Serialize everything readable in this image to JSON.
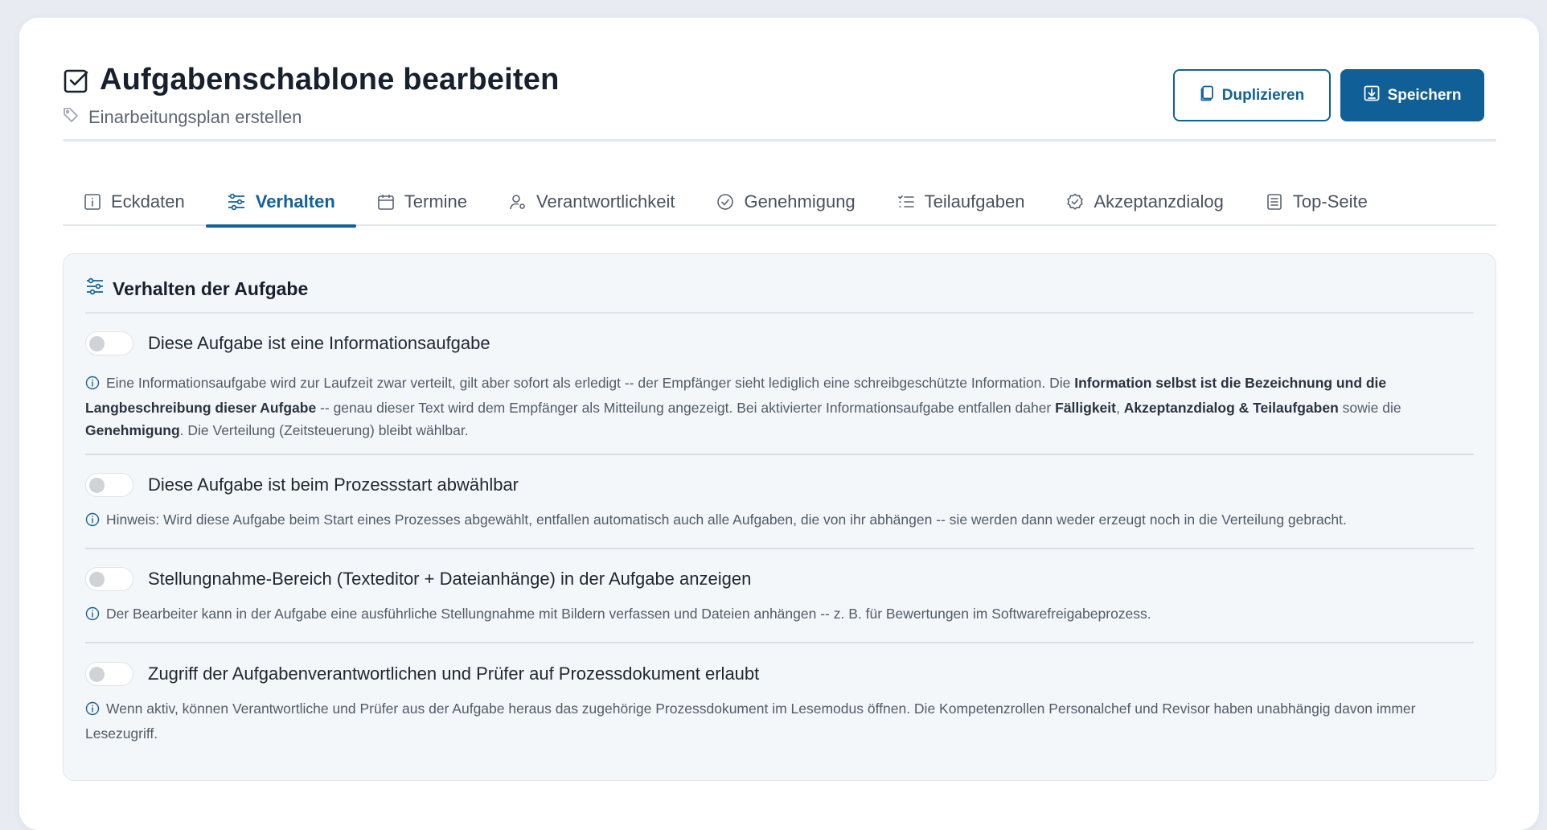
{
  "header": {
    "title": "Aufgabenschablone bearbeiten",
    "subtitle": "Einarbeitungsplan erstellen",
    "title_icon": "checkbox-icon",
    "subtitle_icon": "tag-icon"
  },
  "actions": {
    "duplicate_label": "Duplizieren",
    "save_label": "Speichern"
  },
  "tabs": [
    {
      "label": "Eckdaten",
      "icon": "info-icon",
      "active": false
    },
    {
      "label": "Verhalten",
      "icon": "sliders-icon",
      "active": true
    },
    {
      "label": "Termine",
      "icon": "calendar-icon",
      "active": false
    },
    {
      "label": "Verantwortlichkeit",
      "icon": "user-settings-icon",
      "active": false
    },
    {
      "label": "Genehmigung",
      "icon": "check-circle-icon",
      "active": false
    },
    {
      "label": "Teilaufgaben",
      "icon": "list-check-icon",
      "active": false
    },
    {
      "label": "Akzeptanzdialog",
      "icon": "badge-check-icon",
      "active": false
    },
    {
      "label": "Top-Seite",
      "icon": "document-icon",
      "active": false
    }
  ],
  "panel": {
    "title": "Verhalten der Aufgabe",
    "options": [
      {
        "label": "Diese Aufgabe ist eine Informationsaufgabe",
        "enabled": false,
        "help": [
          {
            "t": "Eine Informationsaufgabe wird zur Laufzeit zwar verteilt, gilt aber sofort als erledigt -- der Empfänger sieht lediglich eine schreibgeschützte Information. Die "
          },
          {
            "t": "Information selbst ist die Bezeichnung und die Langbeschreibung dieser Aufgabe",
            "b": true
          },
          {
            "t": " -- genau dieser Text wird dem Empfänger als Mitteilung angezeigt. Bei aktivierter Informationsaufgabe entfallen daher "
          },
          {
            "t": "Fälligkeit",
            "b": true
          },
          {
            "t": ", "
          },
          {
            "t": "Akzeptanzdialog & Teilaufgaben",
            "b": true
          },
          {
            "t": " sowie die "
          },
          {
            "t": "Genehmigung",
            "b": true
          },
          {
            "t": ". Die Verteilung (Zeitsteuerung) bleibt wählbar."
          }
        ]
      },
      {
        "label": "Diese Aufgabe ist beim Prozessstart abwählbar",
        "enabled": false,
        "help": [
          {
            "t": "Hinweis: Wird diese Aufgabe beim Start eines Prozesses abgewählt, entfallen automatisch auch alle Aufgaben, die von ihr abhängen -- sie werden dann weder erzeugt noch in die Verteilung gebracht."
          }
        ]
      },
      {
        "label": "Stellungnahme-Bereich (Texteditor + Dateianhänge) in der Aufgabe anzeigen",
        "enabled": false,
        "help": [
          {
            "t": "Der Bearbeiter kann in der Aufgabe eine ausführliche Stellungnahme mit Bildern verfassen und Dateien anhängen -- z. B. für Bewertungen im Softwarefreigabeprozess."
          }
        ]
      },
      {
        "label": "Zugriff der Aufgabenverantwortlichen und Prüfer auf Prozessdokument erlaubt",
        "enabled": false,
        "help": [
          {
            "t": "Wenn aktiv, können Verantwortliche und Prüfer aus der Aufgabe heraus das zugehörige Prozessdokument im Lesemodus öffnen. Die Kompetenzrollen Personalchef und Revisor haben unabhängig davon immer Lesezugriff."
          }
        ]
      }
    ]
  },
  "colors": {
    "primary": "#115f97",
    "page_bg": "#e8ecf2",
    "panel_bg": "#f4f7fa",
    "title": "#17202e"
  }
}
